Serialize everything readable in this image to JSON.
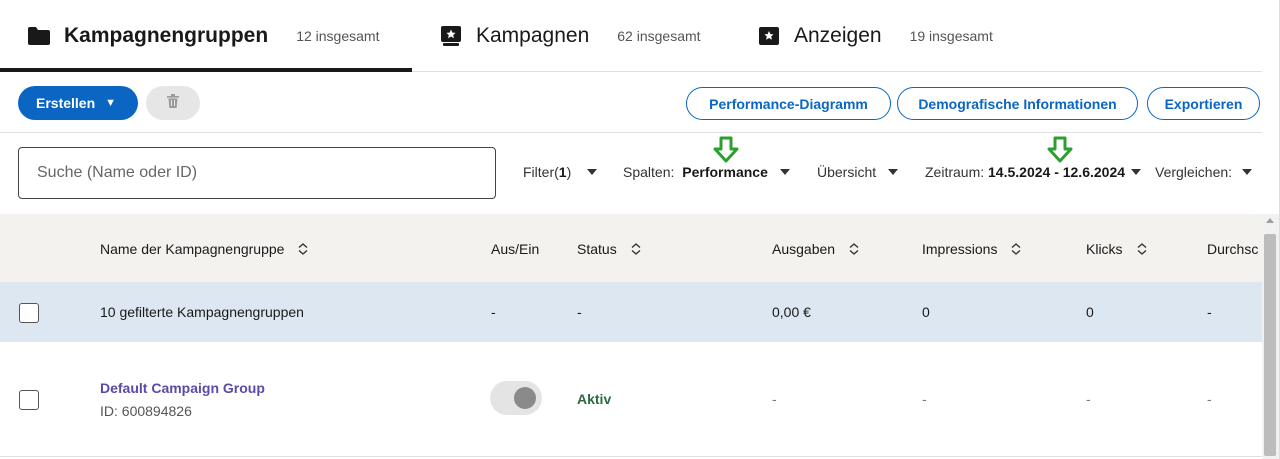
{
  "tabs": [
    {
      "label": "Kampagnengruppen",
      "count": "12 insgesamt",
      "icon": "folder-icon",
      "active": true
    },
    {
      "label": "Kampagnen",
      "count": "62 insgesamt",
      "icon": "campaign-star-icon",
      "active": false
    },
    {
      "label": "Anzeigen",
      "count": "19 insgesamt",
      "icon": "ad-star-icon",
      "active": false
    }
  ],
  "toolbar": {
    "create_label": "Erstellen",
    "performance_chart_label": "Performance-Diagramm",
    "demographics_label": "Demografische Informationen",
    "export_label": "Exportieren"
  },
  "search": {
    "placeholder": "Suche (Name oder ID)"
  },
  "controls": {
    "filter_label": "Filter(",
    "filter_count": "1",
    "filter_close": ")",
    "columns_label": "Spalten:",
    "columns_value": "Performance",
    "overview_label": "Übersicht",
    "date_label": "Zeitraum:",
    "date_value": "14.5.2024 - 12.6.2024",
    "compare_label": "Vergleichen:"
  },
  "table": {
    "headers": {
      "name": "Name der Kampagnengruppe",
      "onoff": "Aus/Ein",
      "status": "Status",
      "spend": "Ausgaben",
      "impressions": "Impressions",
      "clicks": "Klicks",
      "avg": "Durchsc"
    },
    "summary": {
      "name": "10 gefilterte Kampagnengruppen",
      "onoff": "-",
      "status": "-",
      "spend": "0,00 €",
      "impressions": "0",
      "clicks": "0",
      "avg": "-"
    },
    "rows": [
      {
        "name": "Default Campaign Group",
        "id": "ID: 600894826",
        "status": "Aktiv",
        "spend": "-",
        "impressions": "-",
        "clicks": "-",
        "avg": "-",
        "toggle_on": true
      }
    ]
  },
  "colors": {
    "accent": "#0a66c2",
    "annotation_arrow": "#2ca02c",
    "active_status": "#2b6b3f",
    "link": "#5b4aa8"
  }
}
